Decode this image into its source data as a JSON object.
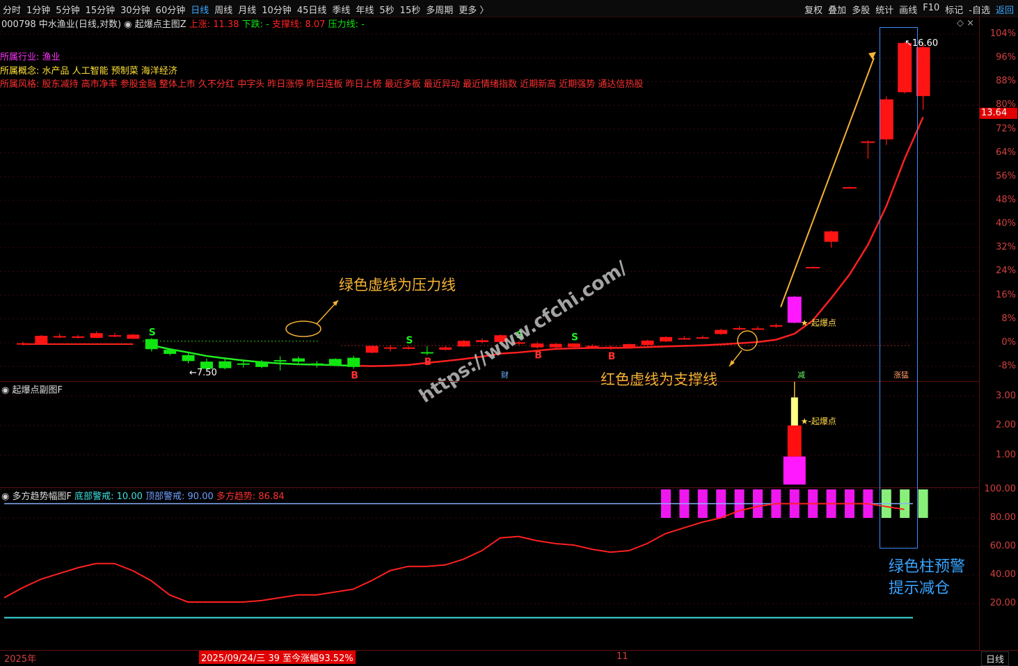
{
  "toolbar": {
    "periods": [
      "分时",
      "1分钟",
      "5分钟",
      "15分钟",
      "30分钟",
      "60分钟",
      "日线",
      "周线",
      "月线",
      "10分钟",
      "45日线",
      "季线",
      "年线",
      "5秒",
      "15秒",
      "多周期",
      "更多 〉"
    ],
    "active_period": "日线",
    "right_items": [
      "复权",
      "叠加",
      "多股",
      "统计",
      "画线",
      "F10",
      "标记",
      "-自选",
      "返回"
    ]
  },
  "main_panel": {
    "code": "000798",
    "name": "中水渔业",
    "mode": "(日线,对数)",
    "indicator": "起爆点主图Z",
    "up_label": "上涨: 11.38",
    "down_label": "下跌: -",
    "support_label": "支撑线: 8.07",
    "pressure_label": "压力线: -",
    "industry_label": "所属行业:",
    "industry": "渔业",
    "concept_label": "所属概念:",
    "concepts": "水产品 人工智能 预制菜 海洋经济",
    "style_label": "所属风格:",
    "styles": "股东减持 高市净率 参股金融 整体上市 久不分红 中字头 昨日涨停 昨日连板 昨日上榜 最近多板 最近异动 最近情绪指数 近期新高 近期强势 通达信热股",
    "current_price": "13.64",
    "high_label": "16.60",
    "low_label": "7.50",
    "ticks": [
      "104%",
      "96%",
      "88%",
      "80%",
      "72%",
      "64%",
      "56%",
      "48%",
      "40%",
      "32%",
      "24%",
      "16%",
      "8%",
      "0%",
      "-8%"
    ],
    "tick_values": [
      104,
      96,
      88,
      80,
      72,
      64,
      56,
      48,
      40,
      32,
      24,
      16,
      8,
      0,
      -8
    ],
    "tags": {
      "cai": "财",
      "jian": "减",
      "zhangting": "涨猛"
    },
    "baseline": "起爆点"
  },
  "annotations": {
    "pressure_note": "绿色虚线为压力线",
    "support_note": "红色虚线为支撑线",
    "green_bar_note_line1": "绿色柱预警",
    "green_bar_note_line2": "提示减仓",
    "watermark": "https://www.cfchi.com/"
  },
  "sub_panel": {
    "title": "起爆点副图F",
    "ticks": [
      "3.00",
      "2.00",
      "1.00"
    ],
    "tick_values": [
      3,
      2,
      1
    ],
    "signal_label": "起爆点"
  },
  "osc_panel": {
    "title": "多方趋势幅图F",
    "bottom_warn_label": "底部警戒:",
    "bottom_warn": "10.00",
    "top_warn_label": "顶部警戒:",
    "top_warn": "90.00",
    "trend_label": "多方趋势:",
    "trend": "86.84",
    "ticks": [
      "100.00",
      "80.00",
      "60.00",
      "40.00",
      "20.00"
    ],
    "tick_values": [
      100,
      80,
      60,
      40,
      20
    ]
  },
  "footer": {
    "year": "2025年",
    "cursor_date": "2025/09/24/三 39 至今涨幅93.52%",
    "month_mark": "11",
    "period": "日线"
  },
  "colors": {
    "up": "#ff1a1a",
    "down": "#11e611",
    "magenta": "#ff19ff",
    "yellow_ann": "#f5b335",
    "blue_note": "#39a3ff",
    "cyan": "#3fe0e0"
  },
  "candles": [
    {
      "o": -0.5,
      "c": -0.2,
      "h": 0.3,
      "l": -1,
      "t": "up"
    },
    {
      "o": -0.3,
      "c": 2.3,
      "h": 2.6,
      "l": -0.4,
      "t": "up"
    },
    {
      "o": 1.8,
      "c": 2.2,
      "h": 3,
      "l": 1.5,
      "t": "up"
    },
    {
      "o": 1.8,
      "c": 2.1,
      "h": 2.6,
      "l": 1.4,
      "t": "up"
    },
    {
      "o": 1.6,
      "c": 3.2,
      "h": 3.8,
      "l": 1.5,
      "t": "up"
    },
    {
      "o": 2.1,
      "c": 2.5,
      "h": 3.2,
      "l": 1.8,
      "t": "up"
    },
    {
      "o": 1.3,
      "c": 2.7,
      "h": 3,
      "l": 1.2,
      "t": "up"
    },
    {
      "o": 1.2,
      "c": -2.2,
      "h": 1.5,
      "l": -3,
      "t": "down"
    },
    {
      "o": -2.4,
      "c": -3.8,
      "h": -2,
      "l": -4.3,
      "t": "down"
    },
    {
      "o": -4.2,
      "c": -6.2,
      "h": -3.5,
      "l": -7,
      "t": "down"
    },
    {
      "o": -6.4,
      "c": -8.8,
      "h": -5.4,
      "l": -9.8,
      "t": "down"
    },
    {
      "o": -6.3,
      "c": -8.6,
      "h": -5.4,
      "l": -9,
      "t": "down"
    },
    {
      "o": -7,
      "c": -7.4,
      "h": -5.8,
      "l": -8.4,
      "t": "down"
    },
    {
      "o": -6.4,
      "c": -8.2,
      "h": -5.9,
      "l": -8.6,
      "t": "down"
    },
    {
      "o": -5.9,
      "c": -6.2,
      "h": -4.6,
      "l": -9.4,
      "t": "down"
    },
    {
      "o": -5.3,
      "c": -6.4,
      "h": -4.7,
      "l": -7,
      "t": "down"
    },
    {
      "o": -7,
      "c": -7.4,
      "h": -6.2,
      "l": -8.4,
      "t": "down"
    },
    {
      "o": -5.5,
      "c": -7.7,
      "h": -5.3,
      "l": -7.9,
      "t": "down"
    },
    {
      "o": -5.1,
      "c": -8.2,
      "h": -4.4,
      "l": -8.8,
      "t": "down"
    },
    {
      "o": -3.4,
      "c": -1.1,
      "h": -1,
      "l": -3.6,
      "t": "up"
    },
    {
      "o": -1.8,
      "c": -1.6,
      "h": -0.8,
      "l": -3,
      "t": "up"
    },
    {
      "o": -2.1,
      "c": -1.6,
      "h": -1.2,
      "l": -2.3,
      "t": "up"
    },
    {
      "o": -3.2,
      "c": -3.4,
      "h": -1.2,
      "l": -4.2,
      "t": "down"
    },
    {
      "o": -2.4,
      "c": -1.6,
      "h": -1.2,
      "l": -2.6,
      "t": "up"
    },
    {
      "o": -1.3,
      "c": 0.6,
      "h": 0.9,
      "l": -1.5,
      "t": "up"
    },
    {
      "o": 0.2,
      "c": 0.8,
      "h": 1.4,
      "l": -0.2,
      "t": "up"
    },
    {
      "o": 0.2,
      "c": 2.5,
      "h": 2.8,
      "l": 0.1,
      "t": "up"
    },
    {
      "o": 0.1,
      "c": -0.3,
      "h": 0.6,
      "l": -0.8,
      "t": "up"
    },
    {
      "o": -0.3,
      "c": -1.6,
      "h": 0.3,
      "l": -2,
      "t": "up"
    },
    {
      "o": -1.6,
      "c": -0.4,
      "h": -0.2,
      "l": -1.8,
      "t": "up"
    },
    {
      "o": -1.5,
      "c": -0.3,
      "h": -0.2,
      "l": -1.8,
      "t": "up"
    },
    {
      "o": -1.1,
      "c": -1.4,
      "h": -0.6,
      "l": -1.9,
      "t": "up"
    },
    {
      "o": -1.4,
      "c": -1.8,
      "h": -1,
      "l": -2.4,
      "t": "up"
    },
    {
      "o": -1.5,
      "c": -0.5,
      "h": -0.3,
      "l": -1.8,
      "t": "up"
    },
    {
      "o": -0.8,
      "c": 0.7,
      "h": 1,
      "l": -1,
      "t": "up"
    },
    {
      "o": 0.4,
      "c": 1.9,
      "h": 2.1,
      "l": 0.2,
      "t": "up"
    },
    {
      "o": 1.3,
      "c": 1.5,
      "h": 2.2,
      "l": 1,
      "t": "up"
    },
    {
      "o": 1.7,
      "c": 1.8,
      "h": 2.4,
      "l": 1.3,
      "t": "up"
    },
    {
      "o": 2.9,
      "c": 4.3,
      "h": 4.6,
      "l": 2.7,
      "t": "up"
    },
    {
      "o": 4.6,
      "c": 4.9,
      "h": 5.6,
      "l": 4.2,
      "t": "up"
    },
    {
      "o": 4.5,
      "c": 4.8,
      "h": 5.5,
      "l": 4.3,
      "t": "up"
    },
    {
      "o": 5.4,
      "c": 5.9,
      "h": 6.4,
      "l": 5,
      "t": "up"
    },
    {
      "o": 6.7,
      "c": 15.5,
      "h": 15.7,
      "l": 6.5,
      "t": "mag"
    },
    {
      "o": 25.3,
      "c": 25.5,
      "h": 25.6,
      "l": 25.2,
      "t": "up"
    },
    {
      "o": 34,
      "c": 37.5,
      "h": 37.8,
      "l": 32,
      "t": "up"
    },
    {
      "o": 52.2,
      "c": 52.4,
      "h": 52.6,
      "l": 52,
      "t": "up"
    },
    {
      "o": 67.6,
      "c": 67.8,
      "h": 68.2,
      "l": 62,
      "t": "up"
    },
    {
      "o": 68.5,
      "c": 82,
      "h": 83,
      "l": 66.6,
      "t": "up"
    },
    {
      "o": 84.4,
      "c": 101,
      "h": 101.4,
      "l": 84,
      "t": "up"
    },
    {
      "o": 83.1,
      "c": 99.6,
      "h": 101,
      "l": 78.5,
      "t": "up"
    }
  ],
  "ma_line": [
    -0.5,
    -0.5,
    -0.5,
    -0.5,
    -0.5,
    -0.5,
    -0.5,
    -0.9,
    -2.2,
    -3.3,
    -4.5,
    -5.3,
    -6,
    -6.6,
    -7,
    -7.3,
    -7.4,
    -7.6,
    -7.8,
    -7.9,
    -7.8,
    -7.5,
    -6.8,
    -6.2,
    -5.5,
    -4.7,
    -3.7,
    -3.3,
    -2.7,
    -2.1,
    -1.9,
    -1.8,
    -1.8,
    -1.7,
    -1.5,
    -1.3,
    -1.1,
    -0.9,
    -0.6,
    -0.2,
    0.2,
    1,
    3,
    7.5,
    15,
    23,
    33,
    46,
    62,
    76
  ],
  "sub_bars": [
    {
      "lo": 0,
      "hi": 0.95,
      "c": "#ff19ff",
      "w": 32
    },
    {
      "lo": 0.95,
      "hi": 2.0,
      "c": "#ff0f0f",
      "w": 20
    },
    {
      "lo": 2.0,
      "hi": 2.95,
      "c": "#ffff88",
      "w": 10
    }
  ],
  "osc_line": [
    24,
    31,
    37,
    41,
    45,
    48,
    48,
    43,
    36,
    26,
    21,
    21,
    21,
    21,
    22,
    24,
    26,
    26,
    28,
    30,
    36,
    43,
    46,
    46,
    47,
    51,
    57,
    66,
    67,
    64,
    62,
    61,
    58,
    56,
    57,
    62,
    69,
    73,
    77,
    80,
    85,
    88,
    90,
    90,
    90,
    90,
    90,
    90,
    88,
    86
  ],
  "osc_bars": [
    "m",
    "m",
    "m",
    "m",
    "m",
    "m",
    "m",
    "m",
    "m",
    "m",
    "m",
    "m",
    "g",
    "g",
    "g"
  ]
}
